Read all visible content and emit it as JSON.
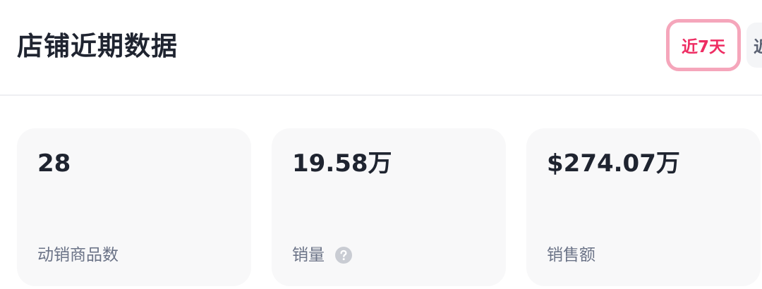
{
  "header": {
    "title": "店铺近期数据",
    "range_tabs": [
      {
        "label": "近7天",
        "active": true
      },
      {
        "label": "近",
        "active": false
      }
    ]
  },
  "metrics": [
    {
      "value": "28",
      "label": "动销商品数"
    },
    {
      "value": "19.58万",
      "label": "销量",
      "has_help_icon": true
    },
    {
      "value": "$274.07万",
      "label": "销售额"
    }
  ],
  "colors": {
    "accent": "#ee2d63",
    "accent_border": "#f5a6bb",
    "card_bg": "#f8f8f9",
    "text_primary": "#1f2430",
    "text_secondary": "#6b7387",
    "help_icon": "#c9ccd3"
  },
  "icons": {
    "help": "question-circle-icon"
  }
}
